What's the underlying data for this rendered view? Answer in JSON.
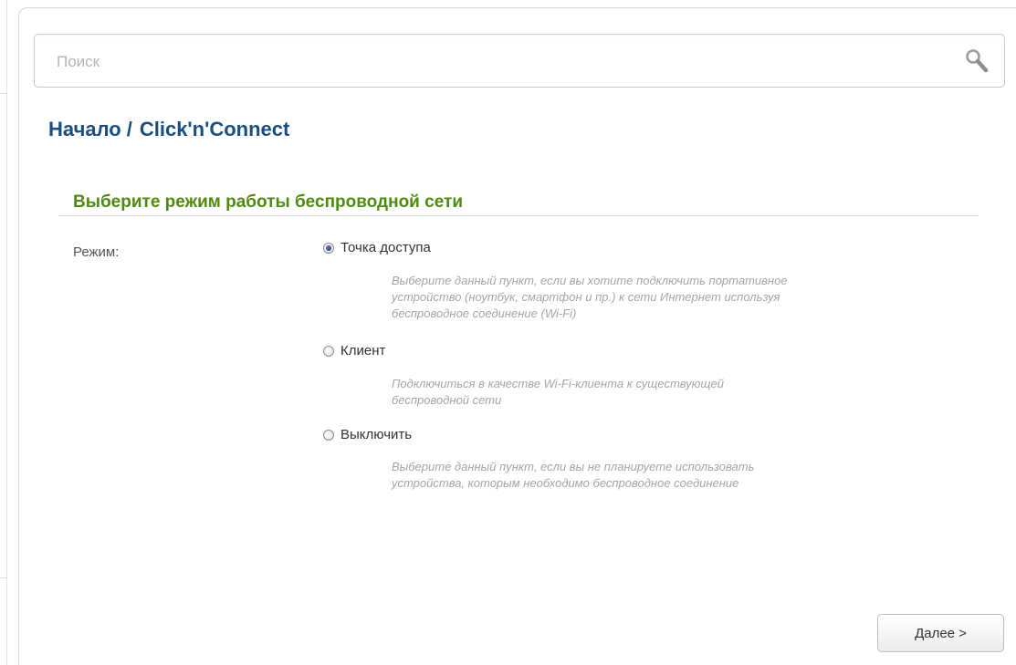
{
  "search": {
    "placeholder": "Поиск",
    "value": ""
  },
  "breadcrumb": {
    "home": "Начало",
    "separator": "/",
    "current": "Click'n'Connect"
  },
  "section": {
    "title": "Выберите режим работы беспроводной сети"
  },
  "form": {
    "mode_label": "Режим:",
    "options": [
      {
        "label": "Точка доступа",
        "selected": true,
        "description": [
          "Выберите данный пункт, если вы хотите подключить портативное",
          "устройство (ноутбук, смартфон и пр.) к сети Интернет используя",
          "беспроводное соединение (Wi-Fi)"
        ]
      },
      {
        "label": "Клиент",
        "selected": false,
        "description": [
          "Подключиться в качестве Wi-Fi-клиента к существующей",
          "беспроводной сети"
        ]
      },
      {
        "label": "Выключить",
        "selected": false,
        "description": [
          "Выберите данный пункт, если вы не планируете использовать",
          "устройства, которым необходимо беспроводное соединение"
        ]
      }
    ]
  },
  "footer": {
    "next_label": "Далее >"
  },
  "colors": {
    "breadcrumb": "#1a4d80",
    "section_title": "#4f8a10",
    "description": "#a5a5a5"
  }
}
